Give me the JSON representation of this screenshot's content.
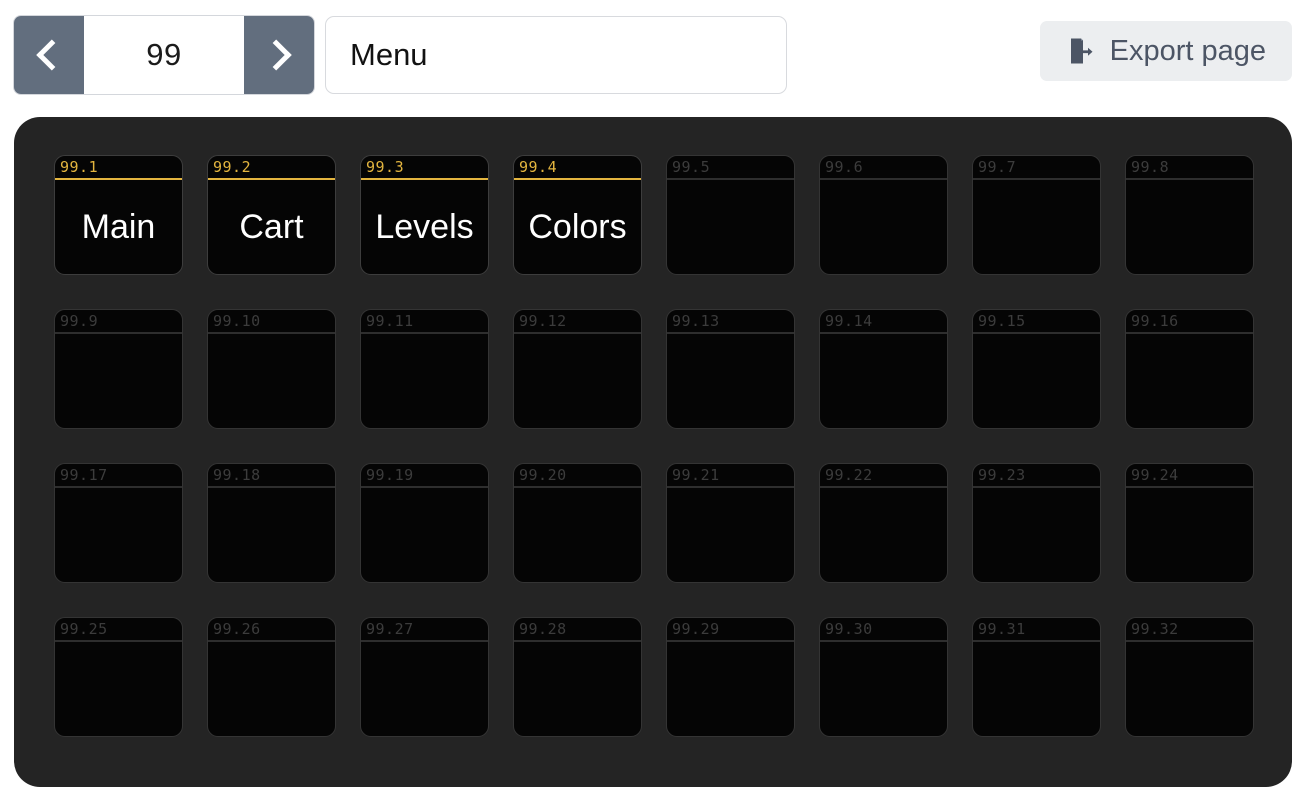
{
  "toolbar": {
    "prev_page_icon": "chevron-left-icon",
    "next_page_icon": "chevron-right-icon",
    "page_number": "99",
    "page_name_value": "Menu",
    "page_name_placeholder": "Page name",
    "export_label": "Export page",
    "export_icon": "file-export-icon"
  },
  "colors": {
    "accent_amber": "#e3b53f",
    "panel_background": "#242424",
    "tile_background": "#050505",
    "stepper_button": "#626e7e",
    "export_button_background": "#eceef0",
    "export_button_text": "#4c5565"
  },
  "grid": {
    "columns": 8,
    "rows": 4,
    "tiles": [
      {
        "id": "99.1",
        "label": "Main",
        "assigned": true
      },
      {
        "id": "99.2",
        "label": "Cart",
        "assigned": true
      },
      {
        "id": "99.3",
        "label": "Levels",
        "assigned": true
      },
      {
        "id": "99.4",
        "label": "Colors",
        "assigned": true
      },
      {
        "id": "99.5",
        "label": "",
        "assigned": false
      },
      {
        "id": "99.6",
        "label": "",
        "assigned": false
      },
      {
        "id": "99.7",
        "label": "",
        "assigned": false
      },
      {
        "id": "99.8",
        "label": "",
        "assigned": false
      },
      {
        "id": "99.9",
        "label": "",
        "assigned": false
      },
      {
        "id": "99.10",
        "label": "",
        "assigned": false
      },
      {
        "id": "99.11",
        "label": "",
        "assigned": false
      },
      {
        "id": "99.12",
        "label": "",
        "assigned": false
      },
      {
        "id": "99.13",
        "label": "",
        "assigned": false
      },
      {
        "id": "99.14",
        "label": "",
        "assigned": false
      },
      {
        "id": "99.15",
        "label": "",
        "assigned": false
      },
      {
        "id": "99.16",
        "label": "",
        "assigned": false
      },
      {
        "id": "99.17",
        "label": "",
        "assigned": false
      },
      {
        "id": "99.18",
        "label": "",
        "assigned": false
      },
      {
        "id": "99.19",
        "label": "",
        "assigned": false
      },
      {
        "id": "99.20",
        "label": "",
        "assigned": false
      },
      {
        "id": "99.21",
        "label": "",
        "assigned": false
      },
      {
        "id": "99.22",
        "label": "",
        "assigned": false
      },
      {
        "id": "99.23",
        "label": "",
        "assigned": false
      },
      {
        "id": "99.24",
        "label": "",
        "assigned": false
      },
      {
        "id": "99.25",
        "label": "",
        "assigned": false
      },
      {
        "id": "99.26",
        "label": "",
        "assigned": false
      },
      {
        "id": "99.27",
        "label": "",
        "assigned": false
      },
      {
        "id": "99.28",
        "label": "",
        "assigned": false
      },
      {
        "id": "99.29",
        "label": "",
        "assigned": false
      },
      {
        "id": "99.30",
        "label": "",
        "assigned": false
      },
      {
        "id": "99.31",
        "label": "",
        "assigned": false
      },
      {
        "id": "99.32",
        "label": "",
        "assigned": false
      }
    ]
  }
}
